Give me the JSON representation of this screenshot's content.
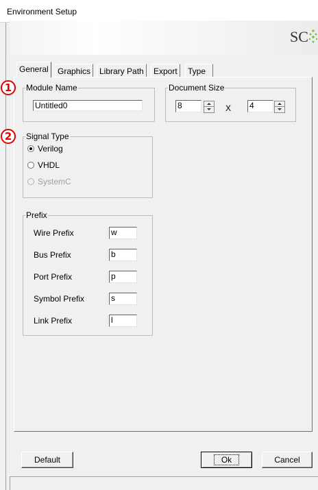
{
  "window": {
    "title": "Environment Setup"
  },
  "banner": {
    "logo_text": "SC"
  },
  "tabs": [
    {
      "label": "General"
    },
    {
      "label": "Graphics"
    },
    {
      "label": "Library Path"
    },
    {
      "label": "Export"
    },
    {
      "label": "Type"
    }
  ],
  "markers": [
    "1",
    "2"
  ],
  "module_name": {
    "title": "Module Name",
    "value": "Untitled0"
  },
  "document_size": {
    "title": "Document Size",
    "width": "8",
    "separator": "X",
    "height": "4"
  },
  "signal_type": {
    "title": "Signal Type",
    "options": [
      {
        "label": "Verilog",
        "selected": true,
        "enabled": true
      },
      {
        "label": "VHDL",
        "selected": false,
        "enabled": true
      },
      {
        "label": "SystemC",
        "selected": false,
        "enabled": false
      }
    ]
  },
  "prefix": {
    "title": "Prefix",
    "items": [
      {
        "label": "Wire Prefix",
        "value": "w"
      },
      {
        "label": "Bus Prefix",
        "value": "b"
      },
      {
        "label": "Port Prefix",
        "value": "p"
      },
      {
        "label": "Symbol Prefix",
        "value": "s"
      },
      {
        "label": "Link Prefix",
        "value": "l"
      }
    ]
  },
  "buttons": {
    "default": "Default",
    "ok": "Ok",
    "cancel": "Cancel"
  },
  "colors": {
    "marker": "#e00000",
    "logo_accent": "#6fbf3a"
  }
}
